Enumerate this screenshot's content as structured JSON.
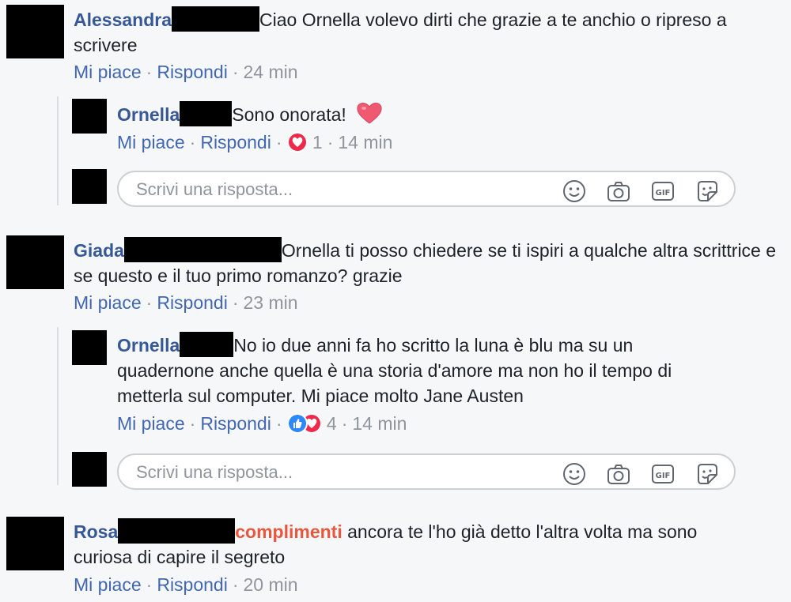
{
  "comments": [
    {
      "name": "Alessandra",
      "text": "Ciao Ornella volevo dirti che grazie a te anchio o ripreso a scrivere",
      "like_label": "Mi piace",
      "reply_label": "Rispondi",
      "time": "24 min",
      "reply": {
        "name": "Ornella",
        "text": "Sono onorata!",
        "like_label": "Mi piace",
        "reply_label": "Rispondi",
        "reaction_count": "1",
        "time": "14 min"
      },
      "reply_placeholder": "Scrivi una risposta..."
    },
    {
      "name": "Giada",
      "text": "Ornella ti posso chiedere se ti ispiri a qualche altra scrittrice e se questo e il tuo primo romanzo? grazie",
      "like_label": "Mi piace",
      "reply_label": "Rispondi",
      "time": "23 min",
      "reply": {
        "name": "Ornella",
        "text": "No io due anni fa ho scritto la luna è blu ma su un quadernone anche quella è una storia d'amore ma non ho il tempo di metterla sul computer. Mi piace molto Jane Austen",
        "like_label": "Mi piace",
        "reply_label": "Rispondi",
        "reaction_count": "4",
        "time": "14 min"
      },
      "reply_placeholder": "Scrivi una risposta..."
    },
    {
      "name": "Rosa",
      "highlight": "complimenti",
      "text": "ancora te l'ho già detto l'altra volta ma sono curiosa di capire il segreto",
      "like_label": "Mi piace",
      "reply_label": "Rispondi",
      "time": "20 min"
    }
  ],
  "separator": "·",
  "colors": {
    "name": "#365899",
    "link": "#4267b2",
    "meta": "#90949c",
    "highlight": "#e9573f",
    "heart": "#f0284a",
    "like": "#2e89ff"
  },
  "icons": [
    "emoji-icon",
    "camera-icon",
    "gif-icon",
    "sticker-icon"
  ]
}
